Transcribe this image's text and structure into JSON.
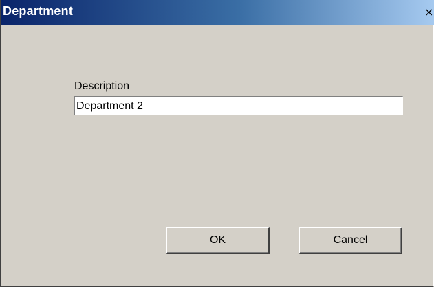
{
  "window": {
    "title": "Department",
    "close_glyph": "×"
  },
  "form": {
    "description_label": "Description",
    "description_value": "Department 2"
  },
  "buttons": {
    "ok_label": "OK",
    "cancel_label": "Cancel"
  },
  "colors": {
    "titlebar_start": "#0a246a",
    "titlebar_end": "#a6caf0",
    "dialog_background": "#d4d0c8"
  }
}
